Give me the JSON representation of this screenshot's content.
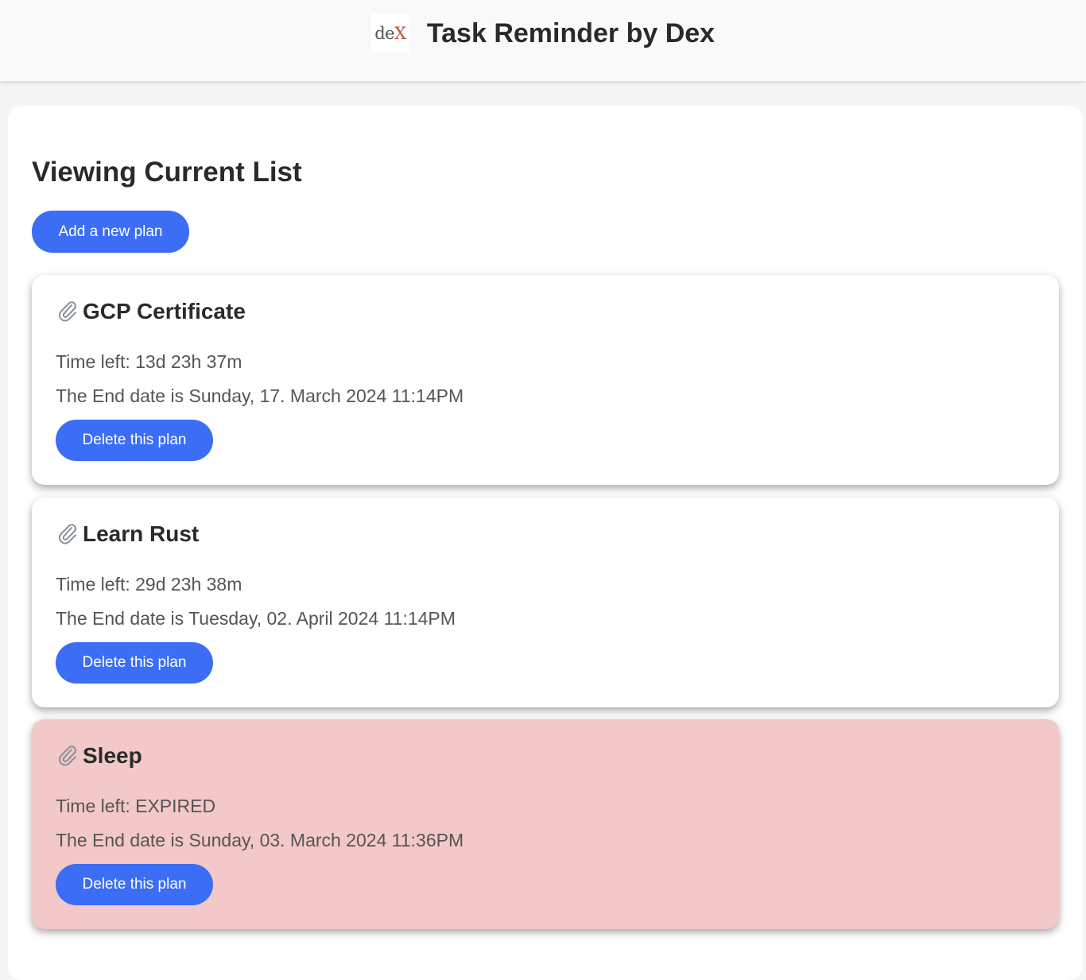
{
  "header": {
    "logo_part1": "de",
    "logo_part2": "X",
    "title": "Task Reminder by Dex"
  },
  "main": {
    "title": "Viewing Current List",
    "add_button_label": "Add a new plan"
  },
  "plans": [
    {
      "name": "GCP Certificate",
      "time_left": "Time left: 13d 23h 37m",
      "end_date": "The End date is Sunday, 17. March 2024 11:14PM",
      "delete_label": "Delete this plan",
      "expired": false
    },
    {
      "name": "Learn Rust",
      "time_left": "Time left: 29d 23h 38m",
      "end_date": "The End date is Tuesday, 02. April 2024 11:14PM",
      "delete_label": "Delete this plan",
      "expired": false
    },
    {
      "name": "Sleep",
      "time_left": "Time left: EXPIRED",
      "end_date": "The End date is Sunday, 03. March 2024 11:36PM",
      "delete_label": "Delete this plan",
      "expired": true
    }
  ],
  "colors": {
    "accent": "#3b6ef5",
    "expired_background": "#f2c8c8",
    "card_background": "#ffffff",
    "page_background": "#f5f5f5"
  },
  "icons": {
    "plan_icon": "paperclip-icon"
  }
}
